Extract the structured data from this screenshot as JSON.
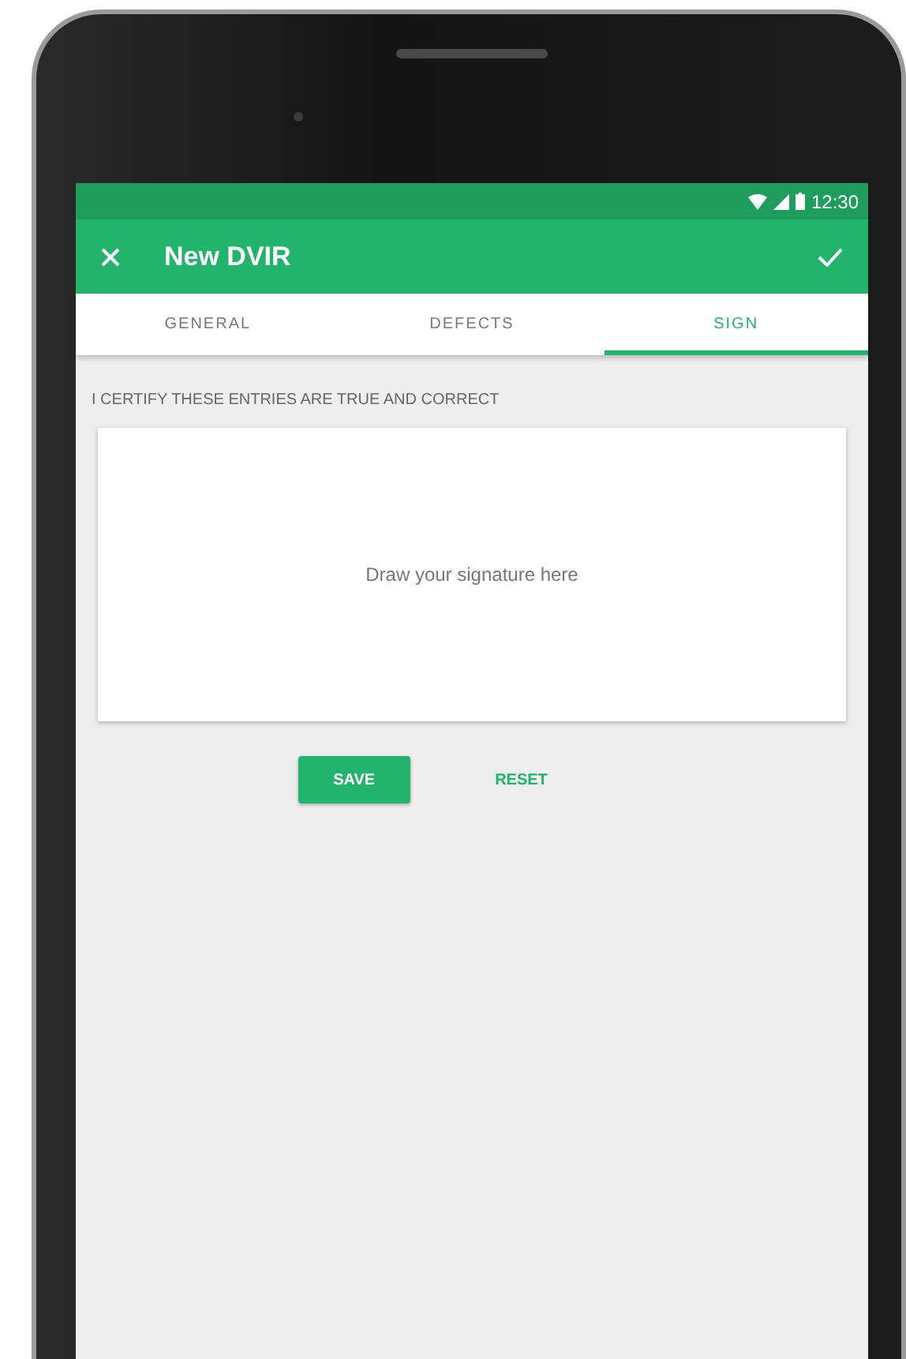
{
  "status_bar": {
    "time": "12:30"
  },
  "app_bar": {
    "title": "New DVIR"
  },
  "tabs": [
    {
      "label": "GENERAL",
      "selected": false
    },
    {
      "label": "DEFECTS",
      "selected": false
    },
    {
      "label": "SIGN",
      "selected": true
    }
  ],
  "certify_label": "I CERTIFY THESE ENTRIES ARE TRUE AND CORRECT",
  "signature_pad": {
    "placeholder": "Draw your signature here"
  },
  "buttons": [
    {
      "label": "SAVE",
      "kind": "primary"
    },
    {
      "label": "RESET",
      "kind": "text"
    }
  ]
}
